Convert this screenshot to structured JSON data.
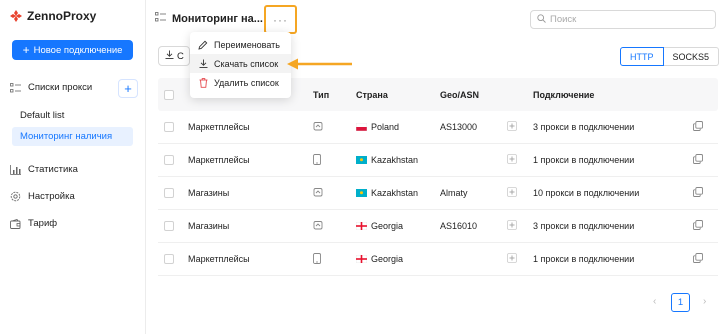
{
  "app": {
    "logo_text": "ZennoProxy"
  },
  "sidebar": {
    "new_button": "Новое подключение",
    "proxy_lists_label": "Списки прокси",
    "lists": [
      {
        "label": "Default list",
        "active": false
      },
      {
        "label": "Мониторинг наличия",
        "active": true
      }
    ],
    "nav": [
      {
        "label": "Статистика",
        "icon": "chart-icon"
      },
      {
        "label": "Настройка",
        "icon": "gear-icon"
      },
      {
        "label": "Тариф",
        "icon": "wallet-icon"
      }
    ]
  },
  "header": {
    "title": "Мониторинг на...",
    "more_label": "···",
    "search_placeholder": "Поиск",
    "download_label": "С",
    "protocols": [
      "HTTP",
      "SOCKS5"
    ],
    "active_protocol": "HTTP"
  },
  "menu": {
    "items": [
      {
        "label": "Переименовать",
        "icon": "pencil-icon"
      },
      {
        "label": "Скачать список",
        "icon": "download-icon"
      },
      {
        "label": "Удалить список",
        "icon": "trash-icon"
      }
    ]
  },
  "table": {
    "headers": {
      "type": "Тип",
      "country": "Страна",
      "geo": "Geo/ASN",
      "connection": "Подключение"
    },
    "rows": [
      {
        "name": "Маркетплейсы",
        "type_icon": "home-icon",
        "country": "Poland",
        "flag": "poland",
        "geo": "AS13000",
        "connection": "3 прокси в подключении"
      },
      {
        "name": "Маркетплейсы",
        "type_icon": "mobile-icon",
        "country": "Kazakhstan",
        "flag": "kazakhstan",
        "geo": "",
        "connection": "1 прокси в подключении"
      },
      {
        "name": "Магазины",
        "type_icon": "home-icon",
        "country": "Kazakhstan",
        "flag": "kazakhstan",
        "geo": "Almaty",
        "connection": "10 прокси в подключении"
      },
      {
        "name": "Магазины",
        "type_icon": "home-icon",
        "country": "Georgia",
        "flag": "georgia",
        "geo": "AS16010",
        "connection": "3 прокси в подключении"
      },
      {
        "name": "Маркетплейсы",
        "type_icon": "mobile-icon",
        "country": "Georgia",
        "flag": "georgia",
        "geo": "",
        "connection": "1 прокси в подключении"
      }
    ]
  },
  "pagination": {
    "current": "1"
  },
  "colors": {
    "accent": "#1677ff",
    "highlight": "#f5a623",
    "logo": "#e8412c"
  }
}
